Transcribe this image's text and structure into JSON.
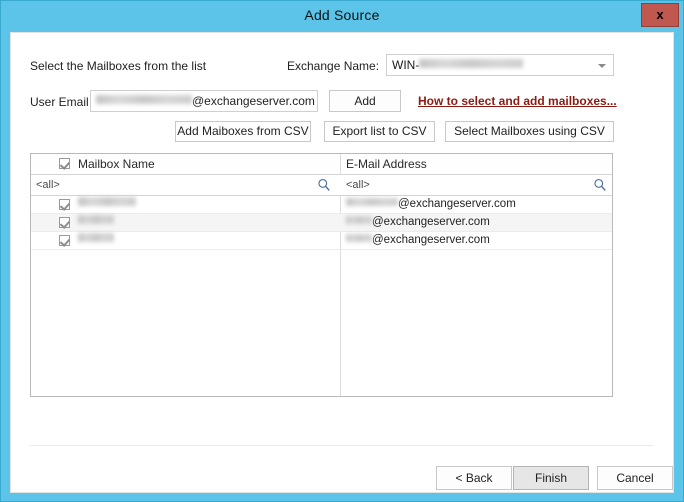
{
  "window": {
    "title": "Add Source",
    "close_label": "x",
    "accent_color": "#5bc4e8",
    "close_color": "#c0584f"
  },
  "form": {
    "instruction": "Select the Mailboxes from the list",
    "exchange_label": "Exchange Name:",
    "exchange_value_prefix": "WIN-",
    "exchange_value_redacted": true,
    "user_email_label": "User Email",
    "user_email_domain": "@exchangeserver.com",
    "user_email_local_redacted": true,
    "add_label": "Add",
    "help_link": "How to select and add mailboxes..."
  },
  "csv_buttons": [
    {
      "label": "Add Maiboxes from CSV",
      "name": "add-mailboxes-from-csv-button"
    },
    {
      "label": "Export list to CSV",
      "name": "export-list-to-csv-button"
    },
    {
      "label": "Select Mailboxes using CSV",
      "name": "select-mailboxes-using-csv-button"
    }
  ],
  "grid": {
    "headers": [
      {
        "label": "Mailbox Name",
        "has_checkbox": true,
        "checked": true
      },
      {
        "label": "E-Mail Address",
        "has_checkbox": false,
        "checked": false
      }
    ],
    "filter_placeholder": "<all>",
    "rows": [
      {
        "checked": true,
        "name_redacted": true,
        "name_width": 58,
        "email_local_width": 52,
        "email_domain": "@exchangeserver.com"
      },
      {
        "checked": true,
        "name_redacted": true,
        "name_width": 36,
        "email_local_width": 26,
        "email_domain": "@exchangeserver.com"
      },
      {
        "checked": true,
        "name_redacted": true,
        "name_width": 36,
        "email_local_width": 26,
        "email_domain": "@exchangeserver.com"
      }
    ]
  },
  "footer": {
    "back_label": "< Back",
    "finish_label": "Finish",
    "cancel_label": "Cancel"
  }
}
